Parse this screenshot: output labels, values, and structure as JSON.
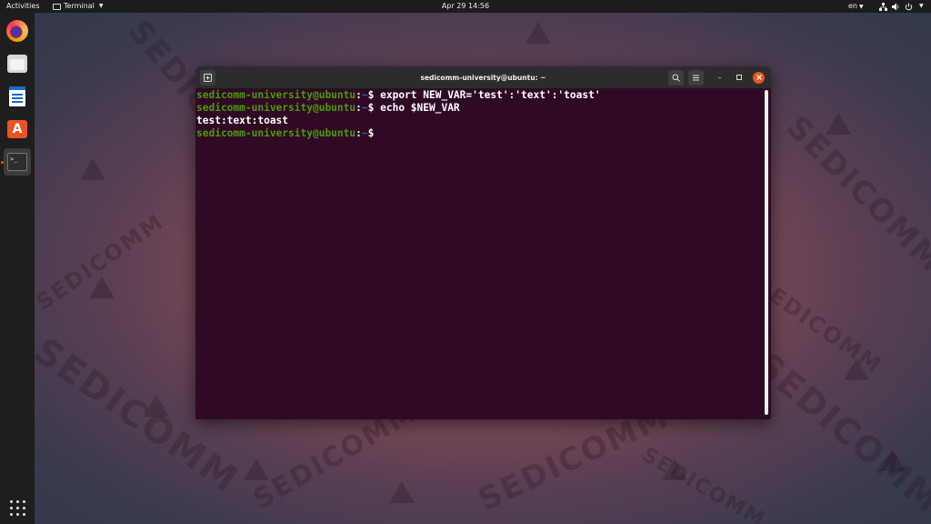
{
  "topbar": {
    "activities": "Activities",
    "app_name": "Terminal",
    "clock": "Apr 29  14:56",
    "lang": "en"
  },
  "dock": {
    "items": [
      {
        "name": "firefox-icon"
      },
      {
        "name": "files-icon"
      },
      {
        "name": "writer-icon"
      },
      {
        "name": "software-icon"
      },
      {
        "name": "terminal-icon",
        "label": ">_"
      }
    ]
  },
  "window": {
    "title": "sedicomm-university@ubuntu: ~",
    "lines": [
      {
        "user": "sedicomm-university@ubuntu",
        "sep": ":",
        "path": "~",
        "sym": "$ ",
        "cmd": "export NEW_VAR='test':'text':'toast'"
      },
      {
        "user": "sedicomm-university@ubuntu",
        "sep": ":",
        "path": "~",
        "sym": "$ ",
        "cmd": "echo $NEW_VAR"
      },
      {
        "output": "test:text:toast"
      },
      {
        "user": "sedicomm-university@ubuntu",
        "sep": ":",
        "path": "~",
        "sym": "$ ",
        "cmd": ""
      }
    ]
  },
  "wallpaper": {
    "brand": "SEDICOMM"
  }
}
